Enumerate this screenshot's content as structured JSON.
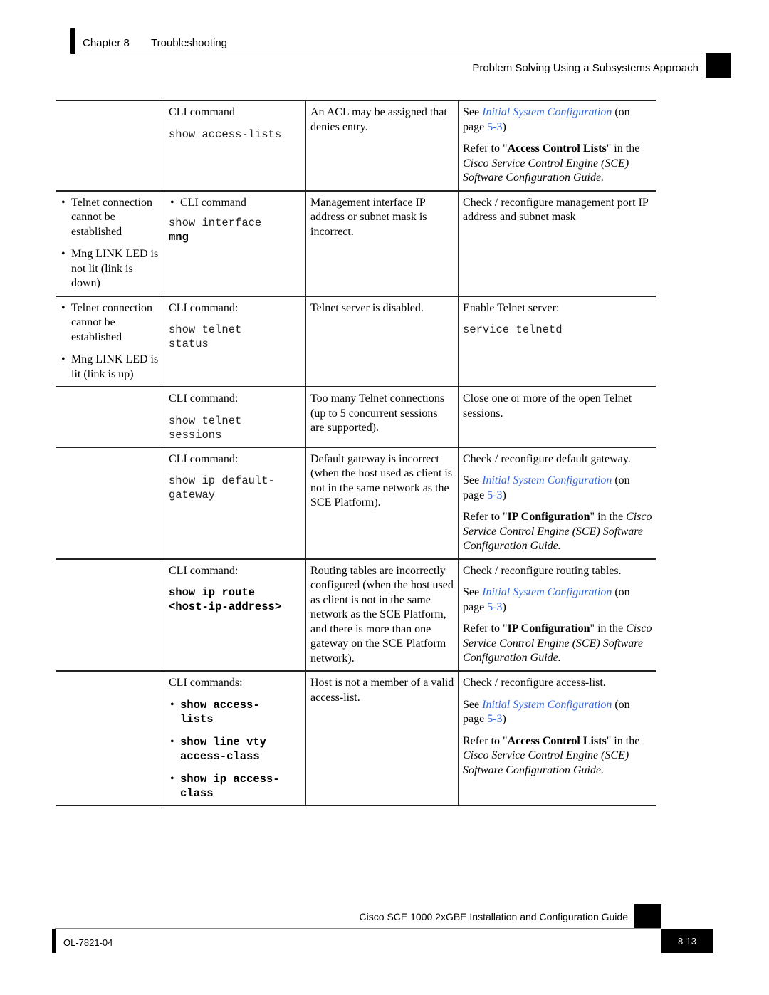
{
  "header": {
    "chapter": "Chapter 8",
    "chapter_title": "Troubleshooting",
    "section": "Problem Solving Using a Subsystems Approach"
  },
  "table": {
    "rows": [
      {
        "symptoms": [],
        "diagnosis_label": "CLI command",
        "diagnosis_commands": [
          "show access-lists"
        ],
        "cause": "An ACL may be assigned that denies entry.",
        "action": {
          "lead": "",
          "see_prefix": "See ",
          "see_link": "Initial System Configuration",
          "see_mid": " (on page ",
          "see_page": "5-3",
          "see_suffix": ")",
          "refer_prefix": "Refer to \"",
          "refer_bold": "Access Control Lists",
          "refer_mid": "\" in the ",
          "refer_italic": "Cisco Service Control Engine (SCE) Software Configuration Guide."
        }
      },
      {
        "symptoms": [
          "Telnet connection cannot be established",
          "Mng LINK LED is not lit (link is down)"
        ],
        "diagnosis_label": "CLI command",
        "diagnosis_commands": [
          "show interface",
          "mng"
        ],
        "cause": "Management interface IP address or subnet mask is incorrect.",
        "action": {
          "text": "Check / reconfigure management port IP address and subnet mask"
        }
      },
      {
        "symptoms": [
          "Telnet connection cannot be established",
          "Mng LINK LED is lit (link is up)"
        ],
        "diagnosis_label": "CLI command:",
        "diagnosis_commands": [
          "show telnet",
          "status"
        ],
        "cause": "Telnet server is disabled.",
        "action": {
          "text": "Enable Telnet server:",
          "command": "service telnetd"
        }
      },
      {
        "symptoms": [],
        "diagnosis_label": "CLI command:",
        "diagnosis_commands": [
          "show telnet",
          "sessions"
        ],
        "cause": "Too many Telnet connections (up to 5 concurrent sessions are supported).",
        "action": {
          "text": "Close one or more of the open Telnet sessions."
        }
      },
      {
        "symptoms": [],
        "diagnosis_label": "CLI command:",
        "diagnosis_commands": [
          "show ip default-",
          "gateway"
        ],
        "cause": "Default gateway is incorrect (when the host used as client is not in the same network as the SCE Platform).",
        "action": {
          "lead": "Check / reconfigure default gateway.",
          "see_prefix": "See ",
          "see_link": "Initial System Configuration",
          "see_mid": " (on page ",
          "see_page": "5-3",
          "see_suffix": ")",
          "refer_prefix": "Refer to \"",
          "refer_bold": "IP Configuration",
          "refer_mid": "\" in the ",
          "refer_italic": "Cisco Service Control Engine (SCE) Software Configuration Guide."
        }
      },
      {
        "symptoms": [],
        "diagnosis_label": "CLI command:",
        "diagnosis_commands": [
          "show ip route",
          "<host-ip-address>"
        ],
        "cause": "Routing tables are incorrectly configured (when the host used as client is not in the same network as the SCE Platform, and there is more than one gateway on the SCE Platform network).",
        "action": {
          "lead": "Check / reconfigure routing tables.",
          "see_prefix": "See ",
          "see_link": "Initial System Configuration",
          "see_mid": " (on page ",
          "see_page": "5-3",
          "see_suffix": ")",
          "refer_prefix": "Refer to \"",
          "refer_bold": "IP Configuration",
          "refer_mid": "\" in the ",
          "refer_italic": "Cisco Service Control Engine (SCE) Software Configuration Guide."
        }
      },
      {
        "symptoms": [],
        "diagnosis_label": "CLI commands:",
        "diagnosis_command_list": [
          [
            "show access-",
            "lists"
          ],
          [
            "show line vty",
            "access-class"
          ],
          [
            "show ip access-",
            "class"
          ]
        ],
        "cause": "Host is not a member of a valid access-list.",
        "action": {
          "lead": "Check / reconfigure access-list.",
          "see_prefix": "See ",
          "see_link": "Initial System Configuration",
          "see_mid": " (on page ",
          "see_page": "5-3",
          "see_suffix": ")",
          "refer_prefix": "Refer to \"",
          "refer_bold": "Access Control Lists",
          "refer_mid": "\" in the ",
          "refer_italic": "Cisco Service Control Engine (SCE) Software Configuration Guide."
        }
      }
    ],
    "bullet": "•"
  },
  "footer": {
    "guide_title": "Cisco SCE 1000 2xGBE Installation and Configuration Guide",
    "doc_number": "OL-7821-04",
    "page_number": "8-13"
  },
  "colors": {
    "link": "#3366dd",
    "rule": "#222222"
  }
}
